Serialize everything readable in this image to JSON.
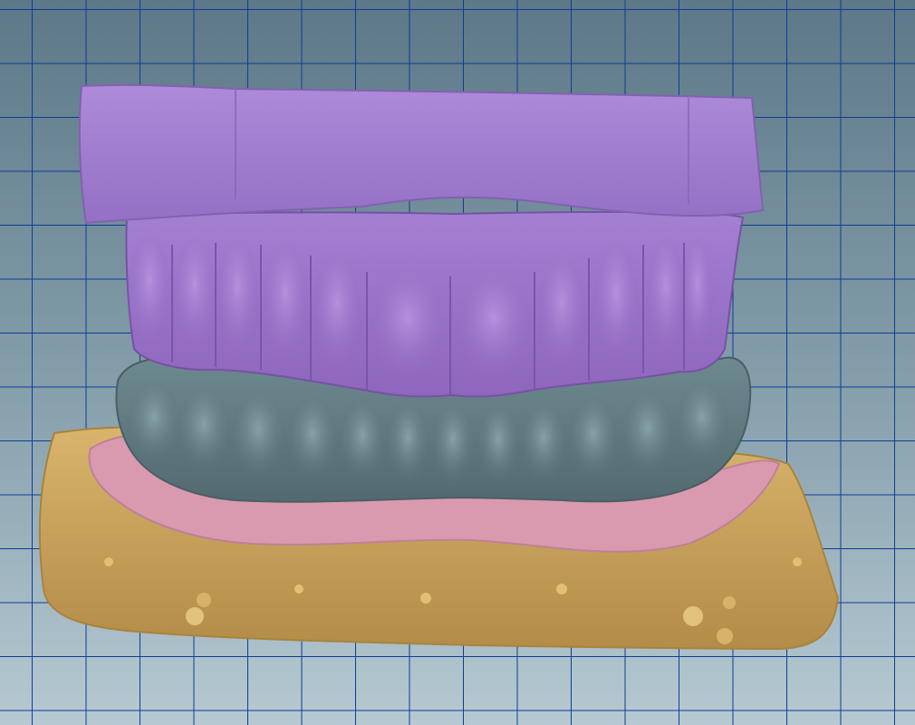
{
  "viewport": {
    "background_top": "#5d7888",
    "background_bottom": "#b3c7d0",
    "grid_color": "#0f3d92"
  },
  "model": {
    "upper_arch_color": "#9a72c8",
    "lower_arch_color": "#5f7a80",
    "gingiva_color": "#d99ab0",
    "base_color": "#c8a35e"
  }
}
